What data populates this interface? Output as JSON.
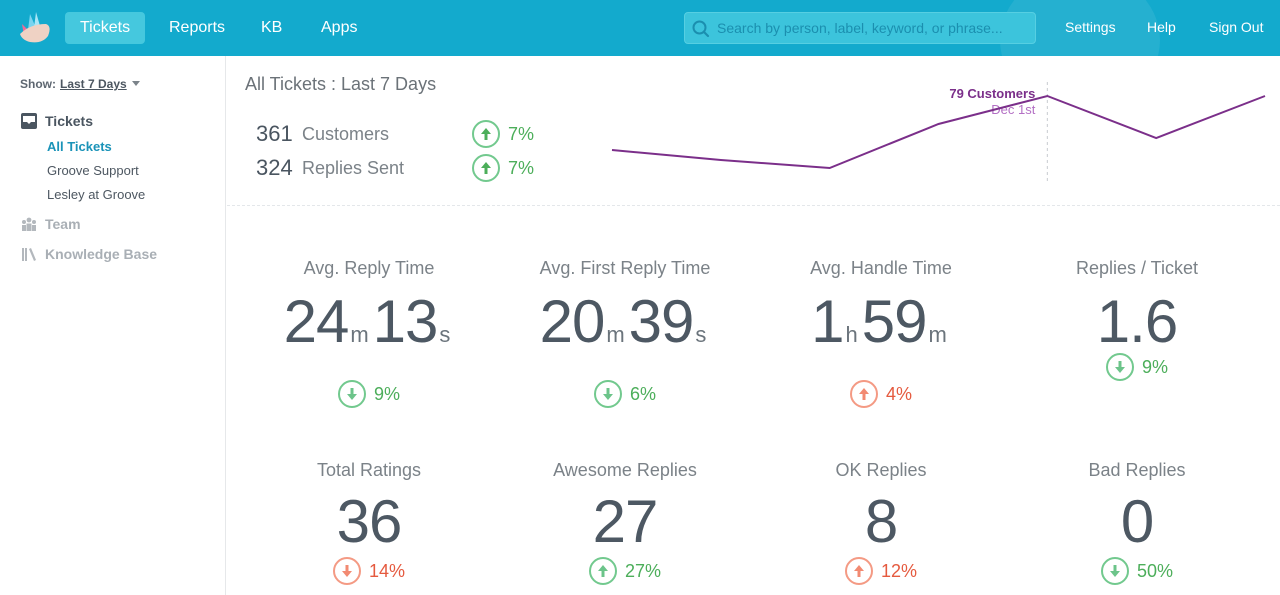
{
  "topbar": {
    "logo_alt": "Groove logo",
    "tabs": [
      {
        "label": "Tickets",
        "active": true
      },
      {
        "label": "Reports",
        "active": false
      },
      {
        "label": "KB",
        "active": false
      },
      {
        "label": "Apps",
        "active": false
      }
    ],
    "search": {
      "placeholder": "Search by person, label, keyword, or phrase...",
      "value": "",
      "icon": "search-icon"
    },
    "links": [
      "Settings",
      "Help",
      "Sign Out"
    ],
    "accent": "#13aacd"
  },
  "sidebar": {
    "show_label": "Show:",
    "show_value": "Last 7 Days",
    "sections": [
      {
        "label": "Tickets",
        "icon": "inbox-icon",
        "items": [
          {
            "label": "All Tickets",
            "active": true
          },
          {
            "label": "Groove Support",
            "active": false
          },
          {
            "label": "Lesley at Groove",
            "active": false
          }
        ]
      },
      {
        "label": "Team",
        "icon": "team-icon"
      },
      {
        "label": "Knowledge Base",
        "icon": "books-icon"
      }
    ]
  },
  "main": {
    "title": "All Tickets : Last 7 Days",
    "summary": [
      {
        "value": "361",
        "label": "Customers",
        "delta": "7%",
        "direction": "up",
        "status": "good"
      },
      {
        "value": "324",
        "label": "Replies Sent",
        "delta": "7%",
        "direction": "up",
        "status": "good"
      }
    ],
    "stats": [
      {
        "title": "Avg. Reply Time",
        "parts": [
          {
            "n": "24",
            "u": "m"
          },
          {
            "n": "13",
            "u": "s"
          }
        ],
        "delta": "9%",
        "direction": "down",
        "status": "good"
      },
      {
        "title": "Avg. First Reply Time",
        "parts": [
          {
            "n": "20",
            "u": "m"
          },
          {
            "n": "39",
            "u": "s"
          }
        ],
        "delta": "6%",
        "direction": "down",
        "status": "good"
      },
      {
        "title": "Avg. Handle Time",
        "parts": [
          {
            "n": "1",
            "u": "h"
          },
          {
            "n": "59",
            "u": "m"
          }
        ],
        "delta": "4%",
        "direction": "up",
        "status": "bad"
      },
      {
        "title": "Replies / Ticket",
        "parts": [
          {
            "n": "1.6",
            "u": ""
          }
        ],
        "delta": "9%",
        "direction": "down",
        "status": "good"
      },
      {
        "title": "Total Ratings",
        "parts": [
          {
            "n": "36",
            "u": ""
          }
        ],
        "delta": "14%",
        "direction": "down",
        "status": "bad"
      },
      {
        "title": "Awesome Replies",
        "parts": [
          {
            "n": "27",
            "u": ""
          }
        ],
        "delta": "27%",
        "direction": "up",
        "status": "good"
      },
      {
        "title": "OK Replies",
        "parts": [
          {
            "n": "8",
            "u": ""
          }
        ],
        "delta": "12%",
        "direction": "up",
        "status": "bad"
      },
      {
        "title": "Bad Replies",
        "parts": [
          {
            "n": "0",
            "u": ""
          }
        ],
        "delta": "50%",
        "direction": "down",
        "status": "good"
      }
    ],
    "colors": {
      "good": "#4cae5a",
      "bad": "#e55a3f",
      "line": "#7b2f8a",
      "tooltip_date": "#b36fc4"
    }
  },
  "chart_data": {
    "type": "line",
    "title": "",
    "series": [
      {
        "name": "Customers",
        "values": [
          52,
          47,
          43,
          65,
          79,
          58,
          79
        ]
      }
    ],
    "x": [
      "",
      "",
      "",
      "",
      "Dec 1st",
      "",
      ""
    ],
    "ylim": [
      30,
      90
    ],
    "tooltip": {
      "index": 4,
      "value_label": "79 Customers",
      "date_label": "Dec 1st"
    },
    "grid": false,
    "legend": "none"
  }
}
